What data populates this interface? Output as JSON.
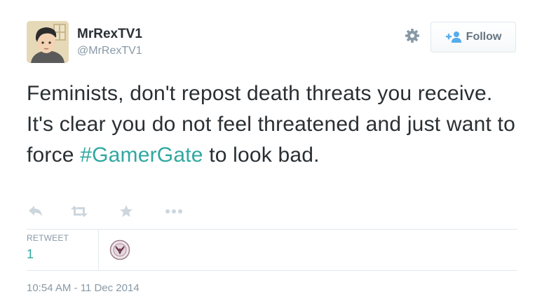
{
  "user": {
    "display_name": "MrRexTV1",
    "screen_name": "@MrRexTV1"
  },
  "header": {
    "follow_label": "Follow"
  },
  "tweet": {
    "text_before": "Feminists, don't repost death threats you receive. It's clear you do not feel threatened and just want to force ",
    "hashtag": "#GamerGate",
    "text_after": " to look bad."
  },
  "stats": {
    "retweet_label": "RETWEET",
    "retweet_count": "1"
  },
  "timestamp": "10:54 AM - 11 Dec 2014",
  "icons": [
    "gear-icon",
    "follow-person-icon",
    "reply-icon",
    "retweet-icon",
    "favorite-icon",
    "more-icon"
  ],
  "colors": {
    "hashtag": "#2fa8a0",
    "muted": "#8899a6",
    "text": "#292f33",
    "follow_icon": "#55acee"
  }
}
